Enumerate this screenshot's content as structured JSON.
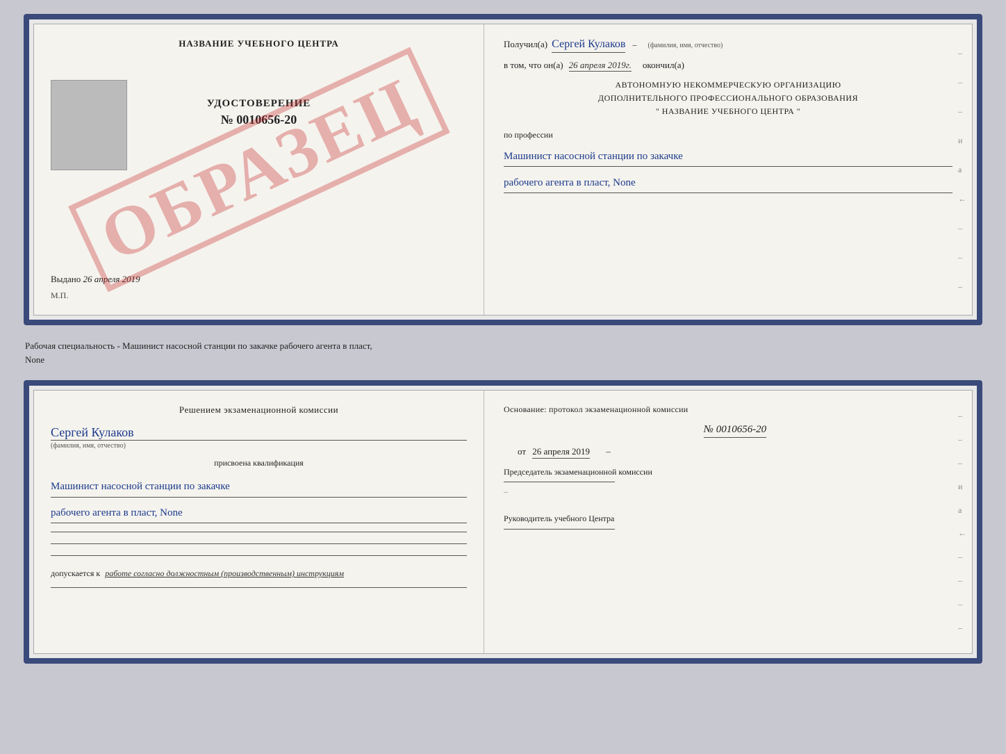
{
  "top_doc": {
    "left": {
      "title": "НАЗВАНИЕ УЧЕБНОГО ЦЕНТРА",
      "cert_label": "УДОСТОВЕРЕНИЕ",
      "cert_number": "№ 0010656-20",
      "issued_label": "Выдано",
      "issued_date": "26 апреля 2019",
      "mp_label": "М.П.",
      "watermark": "ОБРАЗЕЦ"
    },
    "right": {
      "received_label": "Получил(а)",
      "received_name": "Сергей Кулаков",
      "name_sublabel": "(фамилия, имя, отчество)",
      "date_prefix": "в том, что он(а)",
      "date_value": "26 апреля 2019г.",
      "date_suffix": "окончил(а)",
      "org_line1": "АВТОНОМНУЮ НЕКОММЕРЧЕСКУЮ ОРГАНИЗАЦИЮ",
      "org_line2": "ДОПОЛНИТЕЛЬНОГО ПРОФЕССИОНАЛЬНОГО ОБРАЗОВАНИЯ",
      "org_line3": "\" НАЗВАНИЕ УЧЕБНОГО ЦЕНТРА \"",
      "profession_label": "по профессии",
      "profession_line1": "Машинист насосной станции по закачке",
      "profession_line2": "рабочего агента в пласт, None",
      "dashes": [
        "-",
        "-",
        "-",
        "и",
        "а",
        "←",
        "-",
        "-",
        "-"
      ]
    }
  },
  "separator": {
    "text_line1": "Рабочая специальность - Машинист насосной станции по закачке рабочего агента в пласт,",
    "text_line2": "None"
  },
  "bottom_doc": {
    "left": {
      "decision_text": "Решением экзаменационной комиссии",
      "name_handwritten": "Сергей Кулаков",
      "name_sublabel": "(фамилия, имя, отчество)",
      "assigned_label": "присвоена квалификация",
      "qual_line1": "Машинист насосной станции по закачке",
      "qual_line2": "рабочего агента в пласт, None",
      "admits_label": "допускается к",
      "admits_text": "работе согласно должностным (производственным) инструкциям"
    },
    "right": {
      "basis_text": "Основание: протокол экзаменационной комиссии",
      "protocol_number": "№ 0010656-20",
      "from_prefix": "от",
      "from_date": "26 апреля 2019",
      "chairman_label": "Председатель экзаменационной комиссии",
      "head_label": "Руководитель учебного Центра",
      "dashes": [
        "-",
        "-",
        "-",
        "и",
        "а",
        "←",
        "-",
        "-",
        "-",
        "-"
      ]
    }
  }
}
